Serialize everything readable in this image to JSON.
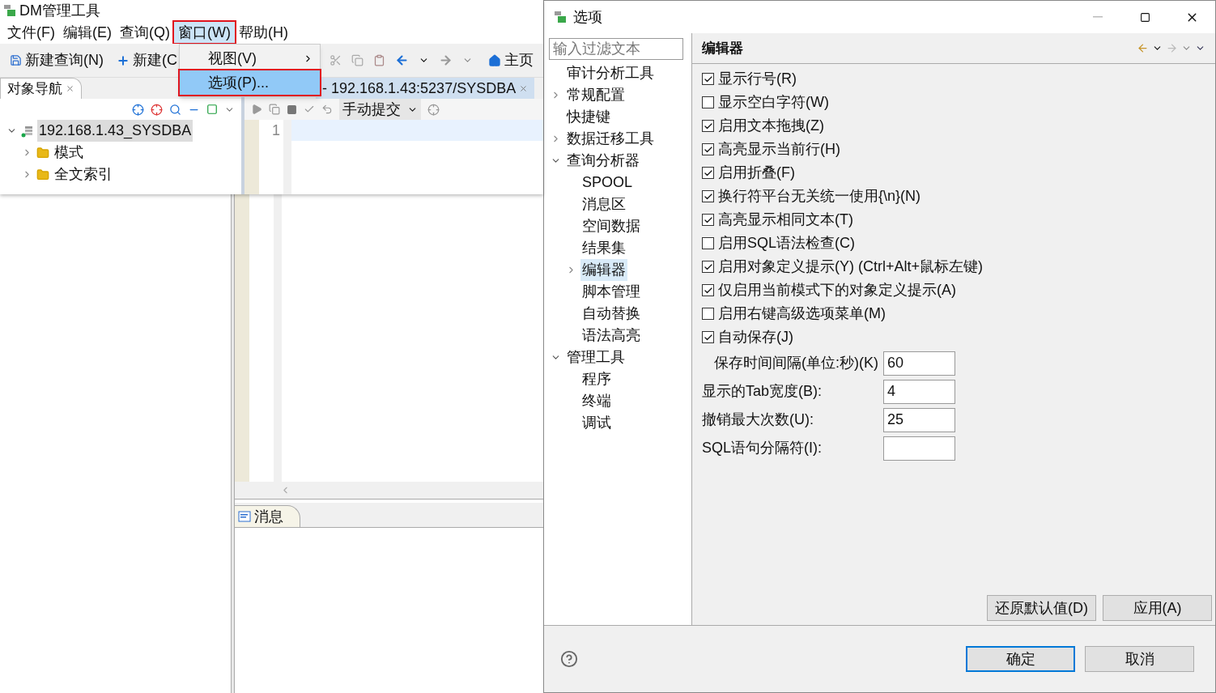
{
  "app": {
    "title": "DM管理工具",
    "menu": [
      {
        "label": "文件(F)",
        "selected": false,
        "highlighted": false
      },
      {
        "label": "编辑(E)",
        "selected": false,
        "highlighted": false
      },
      {
        "label": "查询(Q)",
        "selected": false,
        "highlighted": false
      },
      {
        "label": "窗口(W)",
        "selected": true,
        "highlighted": true
      },
      {
        "label": "帮助(H)",
        "selected": false,
        "highlighted": false
      }
    ],
    "toolbar": {
      "new_query": "新建查询(N)",
      "new": "新建(C",
      "home": "主页"
    },
    "window_menu": [
      {
        "label": "视图(V)",
        "submenu": true,
        "selected": false,
        "highlighted": false
      },
      {
        "label": "选项(P)...",
        "submenu": false,
        "selected": true,
        "highlighted": true
      }
    ],
    "navigator": {
      "tab": "对象导航",
      "tree": [
        {
          "label": "192.168.1.43_SYSDBA",
          "expanded": true,
          "selected": true,
          "children": [
            {
              "label": "模式",
              "expanded": false,
              "selected": false
            },
            {
              "label": "全文索引",
              "expanded": false,
              "selected": false
            }
          ]
        }
      ]
    },
    "editor": {
      "tab": "- 192.168.1.43:5237/SYSDBA",
      "commit_mode": "手动提交",
      "line_numbers": [
        "1"
      ]
    },
    "messages": {
      "tab": "消息"
    }
  },
  "dialog": {
    "title": "选项",
    "filter": {
      "placeholder": "输入过滤文本"
    },
    "tree": [
      {
        "label": "审计分析工具",
        "kind": "leaf",
        "selected": false
      },
      {
        "label": "常规配置",
        "kind": "branch",
        "expanded": false,
        "selected": false
      },
      {
        "label": "快捷键",
        "kind": "leaf",
        "selected": false
      },
      {
        "label": "数据迁移工具",
        "kind": "branch",
        "expanded": false,
        "selected": false
      },
      {
        "label": "查询分析器",
        "kind": "branch",
        "expanded": true,
        "selected": false,
        "children": [
          {
            "label": "SPOOL",
            "kind": "leaf",
            "selected": false
          },
          {
            "label": "消息区",
            "kind": "leaf",
            "selected": false
          },
          {
            "label": "空间数据",
            "kind": "leaf",
            "selected": false
          },
          {
            "label": "结果集",
            "kind": "leaf",
            "selected": false
          },
          {
            "label": "编辑器",
            "kind": "branch",
            "expanded": false,
            "selected": true
          },
          {
            "label": "脚本管理",
            "kind": "leaf",
            "selected": false
          },
          {
            "label": "自动替换",
            "kind": "leaf",
            "selected": false
          },
          {
            "label": "语法高亮",
            "kind": "leaf",
            "selected": false
          }
        ]
      },
      {
        "label": "管理工具",
        "kind": "branch",
        "expanded": true,
        "selected": false,
        "children": [
          {
            "label": "程序",
            "kind": "leaf",
            "selected": false
          },
          {
            "label": "终端",
            "kind": "leaf",
            "selected": false
          },
          {
            "label": "调试",
            "kind": "leaf",
            "selected": false
          }
        ]
      }
    ],
    "page_title": "编辑器",
    "checkboxes": [
      {
        "label": "显示行号(R)",
        "checked": true
      },
      {
        "label": "显示空白字符(W)",
        "checked": false
      },
      {
        "label": "启用文本拖拽(Z)",
        "checked": true
      },
      {
        "label": "高亮显示当前行(H)",
        "checked": true
      },
      {
        "label": "启用折叠(F)",
        "checked": true
      },
      {
        "label": "换行符平台无关统一使用{\\n}(N)",
        "checked": true
      },
      {
        "label": "高亮显示相同文本(T)",
        "checked": true
      },
      {
        "label": "启用SQL语法检查(C)",
        "checked": false
      },
      {
        "label": "启用对象定义提示(Y) (Ctrl+Alt+鼠标左键)",
        "checked": true
      },
      {
        "label": "仅启用当前模式下的对象定义提示(A)",
        "checked": true
      },
      {
        "label": "启用右键高级选项菜单(M)",
        "checked": false
      },
      {
        "label": "自动保存(J)",
        "checked": true
      }
    ],
    "fields": [
      {
        "label": "保存时间间隔(单位:秒)(K)",
        "value": "60",
        "indented": true
      },
      {
        "label": "显示的Tab宽度(B):",
        "value": "4",
        "indented": false
      },
      {
        "label": "撤销最大次数(U):",
        "value": "25",
        "indented": false
      },
      {
        "label": "SQL语句分隔符(I):",
        "indented": false
      }
    ],
    "page_buttons": [
      "还原默认值(D)",
      "应用(A)"
    ],
    "buttons": [
      {
        "label": "确定",
        "default": true
      },
      {
        "label": "取消",
        "default": false
      }
    ]
  }
}
